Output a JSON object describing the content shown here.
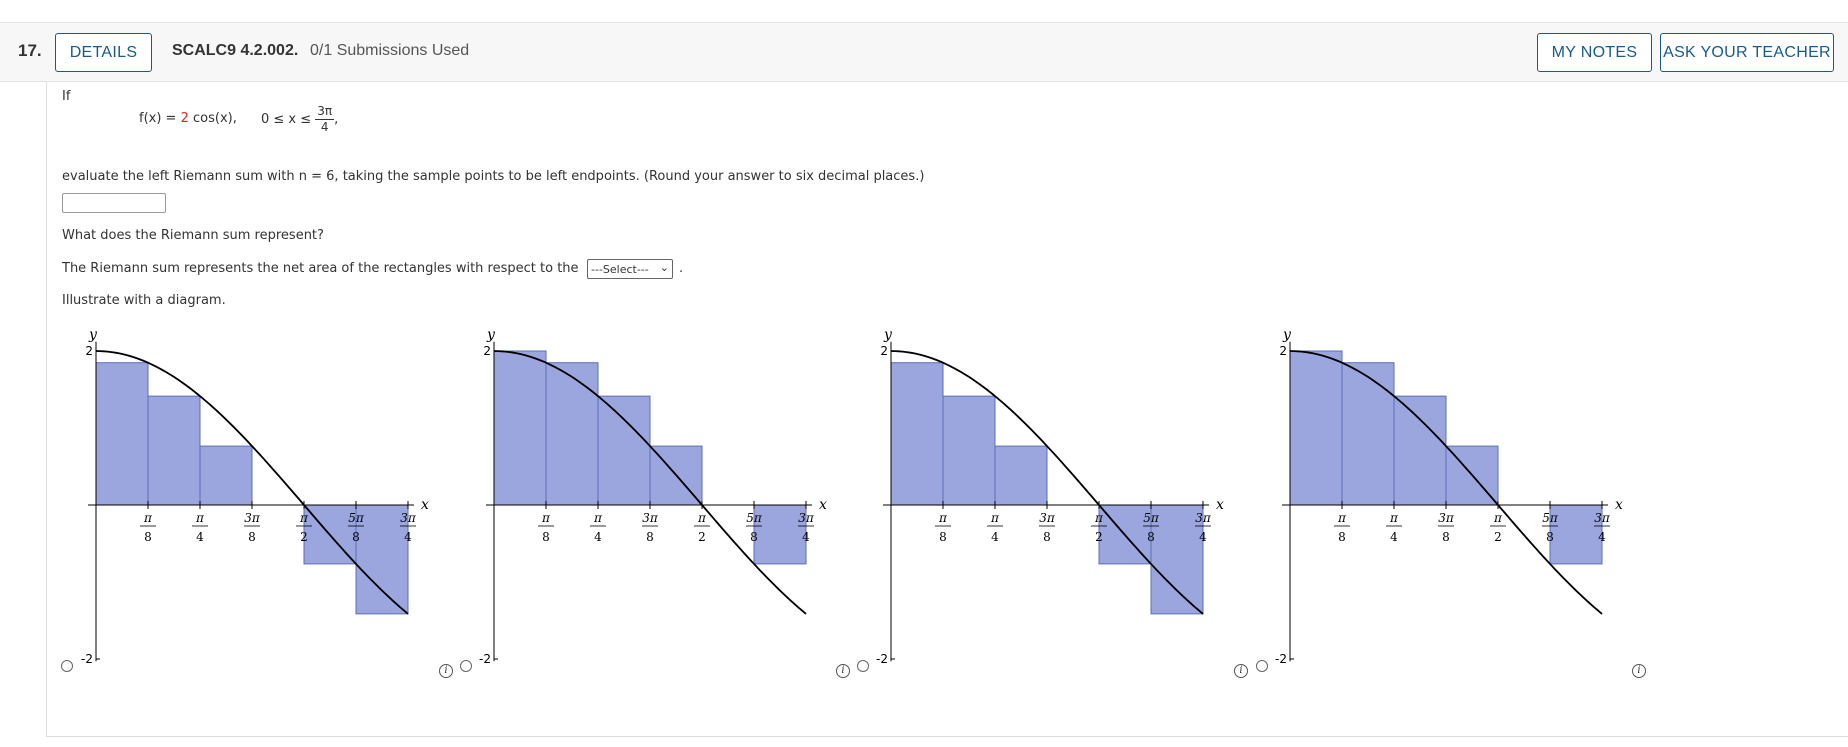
{
  "header": {
    "number": "17.",
    "details_label": "DETAILS",
    "code": "SCALC9 4.2.002.",
    "submissions": "0/1 Submissions Used",
    "notes_label": "MY NOTES",
    "teacher_label": "ASK YOUR TEACHER"
  },
  "question": {
    "if_text": "If",
    "func_lhs": "f(x) = ",
    "func_coef": "2",
    "func_rhs": " cos(x),",
    "domain_text": "0 ≤ x ≤",
    "domain_num": "3π",
    "domain_den": "4",
    "domain_tail": ",",
    "instruction": "evaluate the left Riemann sum with n = 6, taking the sample points to be left endpoints. (Round your answer to six decimal places.)",
    "answer_value": "",
    "represent_q": "What does the Riemann sum represent?",
    "represent_text": "The Riemann sum represents the net area of the rectangles with respect to the",
    "select_value": "---Select---",
    "select_tail": ".",
    "illustrate": "Illustrate with a diagram."
  },
  "chart_data": [
    {
      "type": "area",
      "function": "2cos(x)",
      "xlim": [
        0,
        2.356
      ],
      "ylim": [
        -2,
        2
      ],
      "x_ticks": [
        "π/8",
        "π/4",
        "3π/8",
        "π/2",
        "5π/8",
        "3π/4"
      ],
      "y_ticks": [
        "2",
        "-2"
      ],
      "xlabel": "x",
      "ylabel": "y",
      "rect_heights": [
        1.848,
        1.414,
        0.765,
        0,
        -0.765,
        -1.414
      ]
    },
    {
      "type": "area",
      "function": "2cos(x)",
      "xlim": [
        0,
        2.356
      ],
      "ylim": [
        -2,
        2
      ],
      "x_ticks": [
        "π/8",
        "π/4",
        "3π/8",
        "π/2",
        "5π/8",
        "3π/4"
      ],
      "y_ticks": [
        "2",
        "-2"
      ],
      "xlabel": "x",
      "ylabel": "y",
      "rect_heights": [
        2,
        1.848,
        1.414,
        0.765,
        0,
        -0.765
      ]
    },
    {
      "type": "area",
      "function": "2cos(x)",
      "xlim": [
        0,
        2.356
      ],
      "ylim": [
        -2,
        2
      ],
      "x_ticks": [
        "π/8",
        "π/4",
        "3π/8",
        "π/2",
        "5π/8",
        "3π/4"
      ],
      "y_ticks": [
        "2",
        "-2"
      ],
      "xlabel": "x",
      "ylabel": "y",
      "rect_heights": [
        1.848,
        1.414,
        0.765,
        0,
        -0.765,
        -1.414
      ]
    },
    {
      "type": "area",
      "function": "2cos(x)",
      "xlim": [
        0,
        2.356
      ],
      "ylim": [
        -2,
        2
      ],
      "x_ticks": [
        "π/8",
        "π/4",
        "3π/8",
        "π/2",
        "5π/8",
        "3π/4"
      ],
      "y_ticks": [
        "2",
        "-2"
      ],
      "xlabel": "x",
      "ylabel": "y",
      "rect_heights": [
        2,
        1.848,
        1.414,
        0.765,
        0,
        -0.765
      ]
    }
  ],
  "colors": {
    "rect_fill": "#9ba5de",
    "rect_stroke": "#5a6fb8",
    "curve": "#000000",
    "link": "#1a5a8a"
  }
}
